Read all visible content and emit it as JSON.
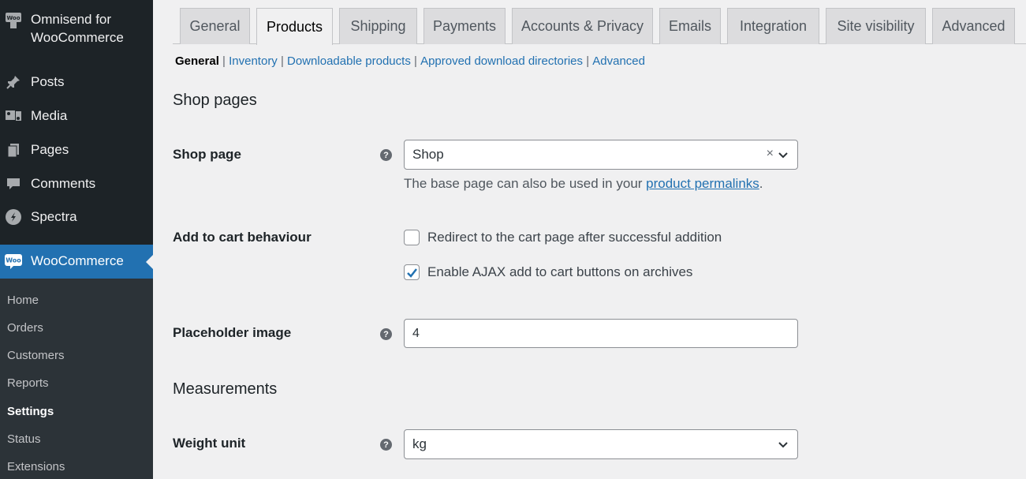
{
  "sidebar": {
    "omnisend": {
      "line1": "Omnisend for",
      "line2": "WooCommerce"
    },
    "items": [
      {
        "label": "Posts",
        "icon": "pin-icon"
      },
      {
        "label": "Media",
        "icon": "media-icon"
      },
      {
        "label": "Pages",
        "icon": "pages-icon"
      },
      {
        "label": "Comments",
        "icon": "comment-icon"
      },
      {
        "label": "Spectra",
        "icon": "spectra-icon"
      }
    ],
    "woocommerce": {
      "label": "WooCommerce",
      "icon_text": "Woo"
    },
    "submenu": [
      "Home",
      "Orders",
      "Customers",
      "Reports",
      "Settings",
      "Status",
      "Extensions"
    ]
  },
  "tabs": [
    "General",
    "Products",
    "Shipping",
    "Payments",
    "Accounts & Privacy",
    "Emails",
    "Integration",
    "Site visibility",
    "Advanced"
  ],
  "subnav": {
    "current": "General",
    "links": [
      "Inventory",
      "Downloadable products",
      "Approved download directories",
      "Advanced"
    ]
  },
  "sections": {
    "shop_pages": "Shop pages",
    "measurements": "Measurements"
  },
  "shop_page": {
    "label": "Shop page",
    "value": "Shop",
    "clear": "×",
    "desc_prefix": "The base page can also be used in your ",
    "desc_link": "product permalinks",
    "desc_suffix": "."
  },
  "add_to_cart": {
    "label": "Add to cart behaviour",
    "redirect": "Redirect to the cart page after successful addition",
    "ajax": "Enable AJAX add to cart buttons on archives"
  },
  "placeholder_image": {
    "label": "Placeholder image",
    "value": "4"
  },
  "weight_unit": {
    "label": "Weight unit",
    "value": "kg"
  },
  "help_glyph": "?",
  "colors": {
    "accent": "#2271b1",
    "sidebar": "#1d2327",
    "submenu": "#2c3338"
  }
}
